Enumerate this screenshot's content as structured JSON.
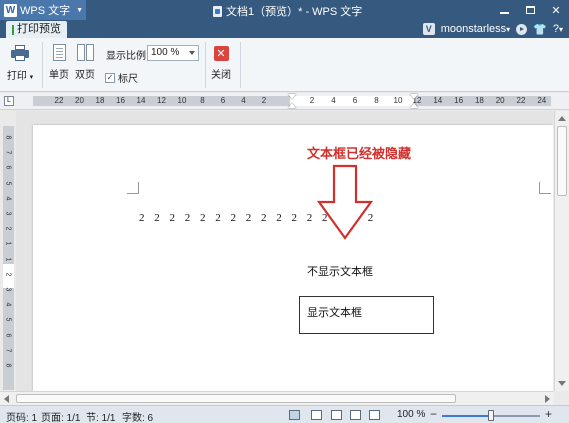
{
  "app": {
    "name": "WPS 文字",
    "logo_letter": "W",
    "window_title": "文档1（预览）* - WPS 文字",
    "colors": {
      "titlebar": "#35597f",
      "accent": "#4a78ad",
      "arrow": "#d0312d",
      "note": "#d0312d"
    }
  },
  "window_controls": {
    "restore": "❐",
    "close": "✕"
  },
  "tabs": {
    "print_preview": "打印预览"
  },
  "user": {
    "badge": "V",
    "name": "moonstarless",
    "caret": "▾",
    "help": "?",
    "help_caret": "▾"
  },
  "toolbar": {
    "print_label": "打印",
    "print_caret": "▾",
    "single_page_label": "单页",
    "double_page_label": "双页",
    "zoom_label": "显示比例",
    "zoom_value": "100 %",
    "ruler_label": "标尺",
    "ruler_checked": true,
    "close_label": "关闭"
  },
  "ruler": {
    "corner": "L",
    "numbers_left": [
      "22",
      "20",
      "18",
      "16",
      "14",
      "12",
      "10",
      "8",
      "6",
      "4",
      "2"
    ],
    "numbers_mid": [
      "2",
      "4",
      "6",
      "8",
      "10"
    ],
    "numbers_right": [
      "12",
      "14",
      "16",
      "18",
      "20",
      "22",
      "24"
    ],
    "vertical_numbers": [
      "8",
      "7",
      "6",
      "5",
      "4",
      "3",
      "2",
      "1",
      "1",
      "2",
      "3",
      "4",
      "5",
      "6",
      "7",
      "8"
    ]
  },
  "document": {
    "digits": "2 2 2 2 2 2 2 2 2 2 2 2 2 2 2 2",
    "hidden_note": "文本框已经被隐藏",
    "no_show_label": "不显示文本框",
    "textbox_text": "显示文本框"
  },
  "status": {
    "page": "页码: 1",
    "pages": "页面: 1/1",
    "section": "节: 1/1",
    "words": "字数: 6",
    "zoom": "100 %",
    "zoom_level_percent": 50,
    "zoom_minus": "−",
    "zoom_plus": "+"
  }
}
